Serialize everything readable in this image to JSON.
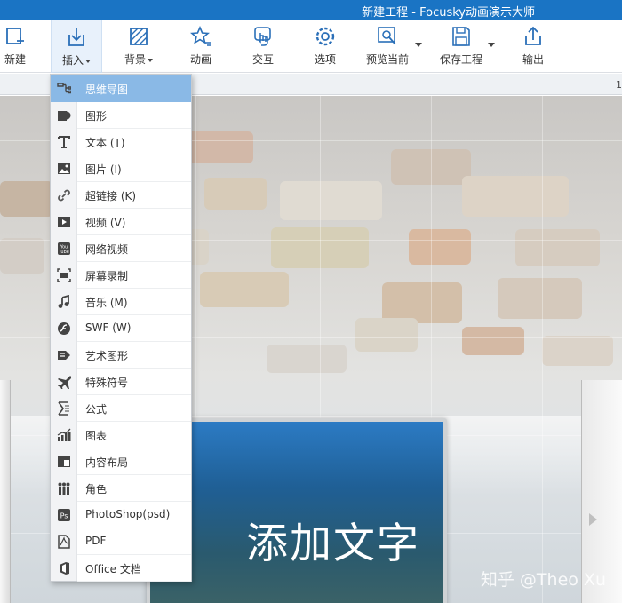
{
  "window": {
    "title": "新建工程 - Focusky动画演示大师"
  },
  "toolbar": {
    "new_label": "新建",
    "insert_label": "插入",
    "background_label": "背景",
    "animation_label": "动画",
    "interaction_label": "交互",
    "options_label": "选项",
    "preview_label": "预览当前",
    "save_label": "保存工程",
    "export_label": "输出"
  },
  "ruler": {
    "right_mark": "1"
  },
  "insert_menu": {
    "items": [
      {
        "label": "思维导图",
        "icon": "mindmap-icon",
        "selected": true
      },
      {
        "label": "图形",
        "icon": "shape-icon"
      },
      {
        "label": "文本 (T)",
        "icon": "text-icon"
      },
      {
        "label": "图片 (I)",
        "icon": "image-icon"
      },
      {
        "label": "超链接 (K)",
        "icon": "link-icon"
      },
      {
        "label": "视频 (V)",
        "icon": "video-icon"
      },
      {
        "label": "网络视频",
        "icon": "youtube-icon"
      },
      {
        "label": "屏幕录制",
        "icon": "screen-record-icon"
      },
      {
        "label": "音乐 (M)",
        "icon": "music-icon"
      },
      {
        "label": "SWF (W)",
        "icon": "flash-icon"
      },
      {
        "label": "艺术图形",
        "icon": "art-shape-icon"
      },
      {
        "label": "特殊符号",
        "icon": "airplane-symbol-icon"
      },
      {
        "label": "公式",
        "icon": "formula-icon"
      },
      {
        "label": "图表",
        "icon": "chart-icon"
      },
      {
        "label": "内容布局",
        "icon": "layout-icon"
      },
      {
        "label": "角色",
        "icon": "character-icon"
      },
      {
        "label": "PhotoShop(psd)",
        "icon": "photoshop-icon"
      },
      {
        "label": "PDF",
        "icon": "pdf-icon"
      },
      {
        "label": "Office 文档",
        "icon": "office-icon"
      }
    ]
  },
  "canvas": {
    "slide_text": "添加文字"
  },
  "watermark": "知乎 @Theo Xu",
  "colors": {
    "titlebar": "#1a74c4",
    "menu_selected": "#8ab9e6",
    "icon_blue": "#2a6fb8"
  }
}
